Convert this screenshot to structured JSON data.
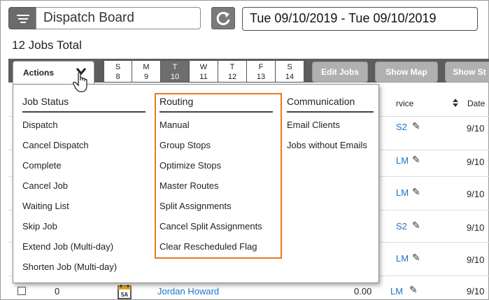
{
  "header": {
    "title": "Dispatch Board",
    "date_range": "Tue 09/10/2019 - Tue 09/10/2019",
    "jobs_total": "12 Jobs Total"
  },
  "toolbar": {
    "actions_label": "Actions",
    "days": [
      {
        "letter": "S",
        "num": "8"
      },
      {
        "letter": "M",
        "num": "9"
      },
      {
        "letter": "T",
        "num": "10"
      },
      {
        "letter": "W",
        "num": "11"
      },
      {
        "letter": "T",
        "num": "12"
      },
      {
        "letter": "F",
        "num": "13"
      },
      {
        "letter": "S",
        "num": "14"
      }
    ],
    "active_day_index": 2,
    "edit_jobs": "Edit Jobs",
    "show_map": "Show Map",
    "show_st": "Show St"
  },
  "table": {
    "service_header": "rvice",
    "date_header": "Date",
    "rows": [
      {
        "service": "S2",
        "date": "9/10"
      },
      {
        "service": "LM",
        "date": "9/10"
      },
      {
        "service": "LM",
        "date": "9/10"
      },
      {
        "service": "S2",
        "date": "9/10"
      },
      {
        "service": "LM",
        "date": "9/10"
      }
    ],
    "last_row": {
      "count": "0",
      "name": "Jordan Howard",
      "amount": "0.00",
      "service": "LM",
      "date": "9/10",
      "cal_label": "5A"
    }
  },
  "dropdown": {
    "job_status": {
      "heading": "Job Status",
      "items": [
        "Dispatch",
        "Cancel Dispatch",
        "Complete",
        "Cancel Job",
        "Waiting List",
        "Skip Job",
        "Extend Job (Multi-day)",
        "Shorten Job (Multi-day)"
      ]
    },
    "routing": {
      "heading": "Routing",
      "items": [
        "Manual",
        "Group Stops",
        "Optimize Stops",
        "Master Routes",
        "Split Assignments",
        "Cancel Split Assignments",
        "Clear Rescheduled Flag"
      ]
    },
    "communication": {
      "heading": "Communication",
      "items": [
        "Email Clients",
        "Jobs without Emails"
      ]
    }
  },
  "colors": {
    "highlight": "#e07a22",
    "link": "#1a73c8",
    "toolbar": "#5d5d5d"
  }
}
